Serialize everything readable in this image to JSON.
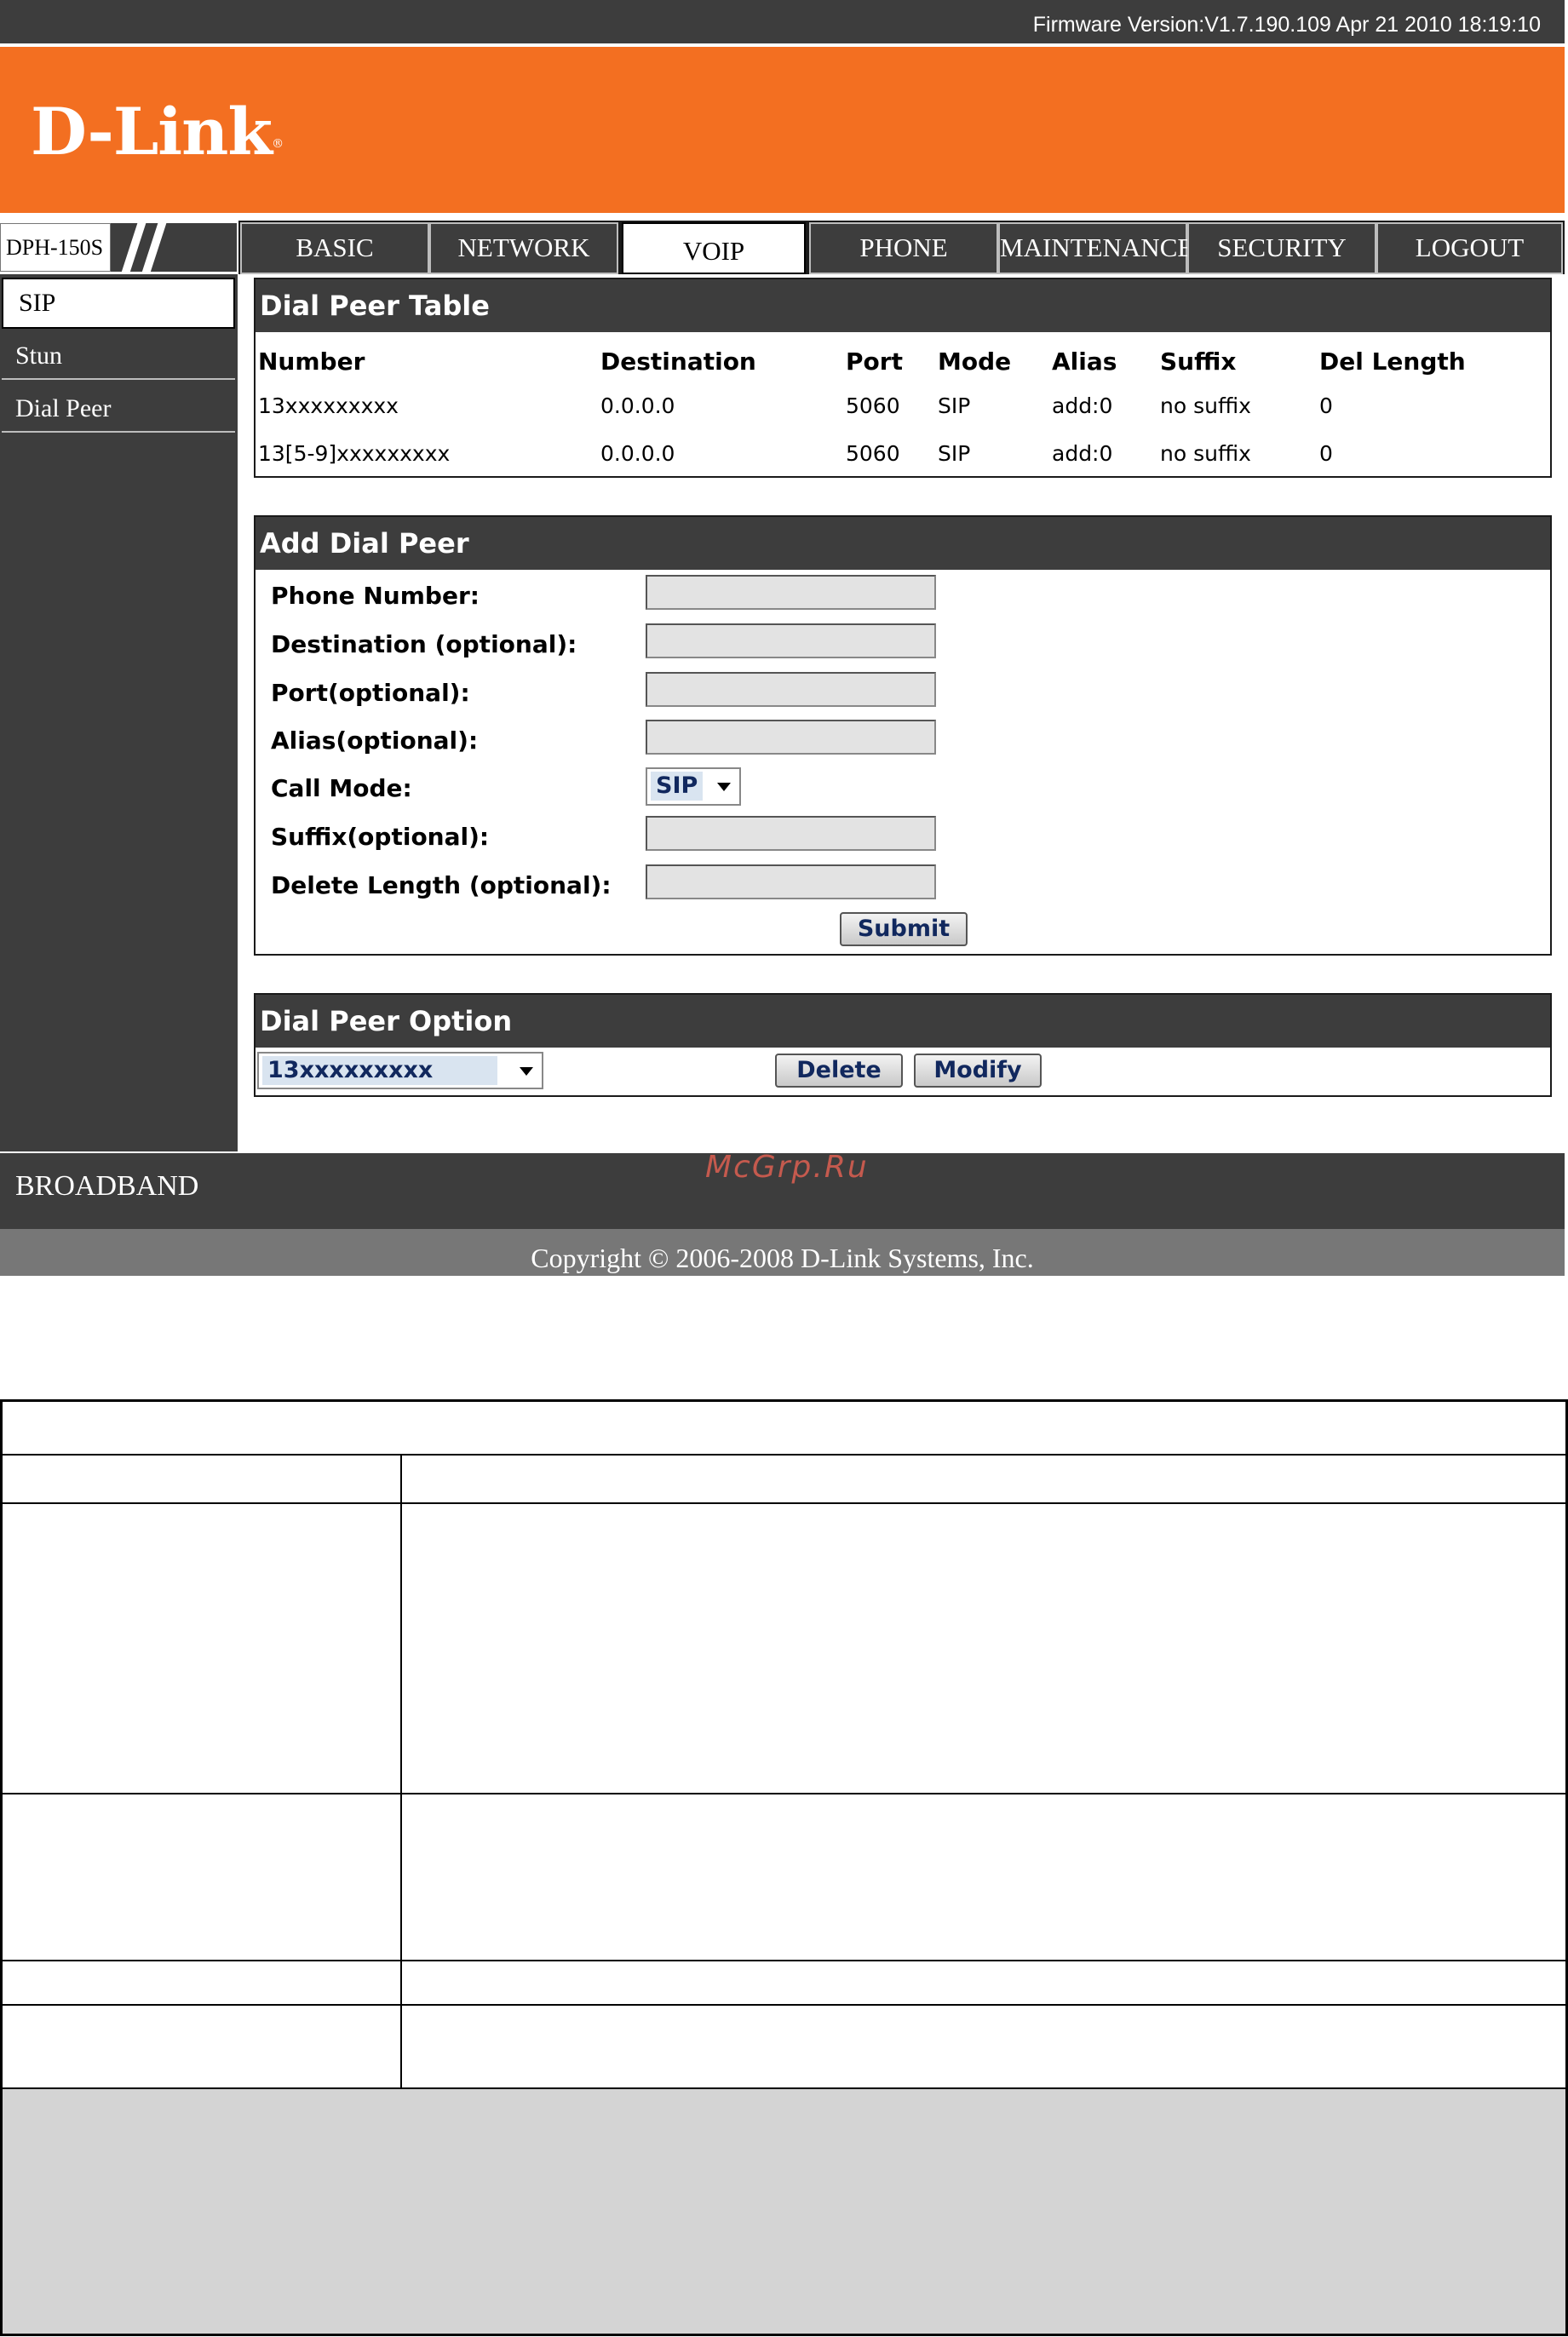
{
  "header": {
    "firmware": "Firmware Version:V1.7.190.109 Apr 21 2010 18:19:10",
    "logo_text": "D-Link",
    "logo_mark": "®",
    "model": "DPH-150S"
  },
  "tabs": [
    {
      "label": "BASIC"
    },
    {
      "label": "NETWORK"
    },
    {
      "label": "VOIP",
      "active": true
    },
    {
      "label": "PHONE"
    },
    {
      "label": "MAINTENANCE"
    },
    {
      "label": "SECURITY"
    },
    {
      "label": "LOGOUT"
    }
  ],
  "sidebar": {
    "items": [
      {
        "label": "SIP",
        "active": true
      },
      {
        "label": "Stun"
      },
      {
        "label": "Dial Peer"
      }
    ]
  },
  "dial_peer_table": {
    "title": "Dial Peer Table",
    "columns": [
      "Number",
      "Destination",
      "Port",
      "Mode",
      "Alias",
      "Suffix",
      "Del Length"
    ],
    "rows": [
      [
        "13xxxxxxxxx",
        "0.0.0.0",
        "5060",
        "SIP",
        "add:0",
        "no suffix",
        "0"
      ],
      [
        "13[5-9]xxxxxxxxx",
        "0.0.0.0",
        "5060",
        "SIP",
        "add:0",
        "no suffix",
        "0"
      ]
    ]
  },
  "add_dial_peer": {
    "title": "Add Dial Peer",
    "fields": [
      {
        "label": "Phone Number:",
        "value": ""
      },
      {
        "label": "Destination (optional):",
        "value": ""
      },
      {
        "label": "Port(optional):",
        "value": ""
      },
      {
        "label": "Alias(optional):",
        "value": ""
      },
      {
        "label": "Call Mode:",
        "value": "SIP"
      },
      {
        "label": "Suffix(optional):",
        "value": ""
      },
      {
        "label": "Delete Length (optional):",
        "value": ""
      }
    ],
    "submit_label": "Submit"
  },
  "dial_peer_option": {
    "title": "Dial Peer Option",
    "selected": "13xxxxxxxxx",
    "delete_label": "Delete",
    "modify_label": "Modify"
  },
  "footer": {
    "broadband": "BROADBAND",
    "watermark": "McGrp.Ru",
    "copyright": "Copyright © 2006-2008 D-Link Systems, Inc."
  },
  "colors": {
    "brand_orange": "#f36f21",
    "dark_gray": "#3d3d3d",
    "button_text": "#11285e"
  }
}
